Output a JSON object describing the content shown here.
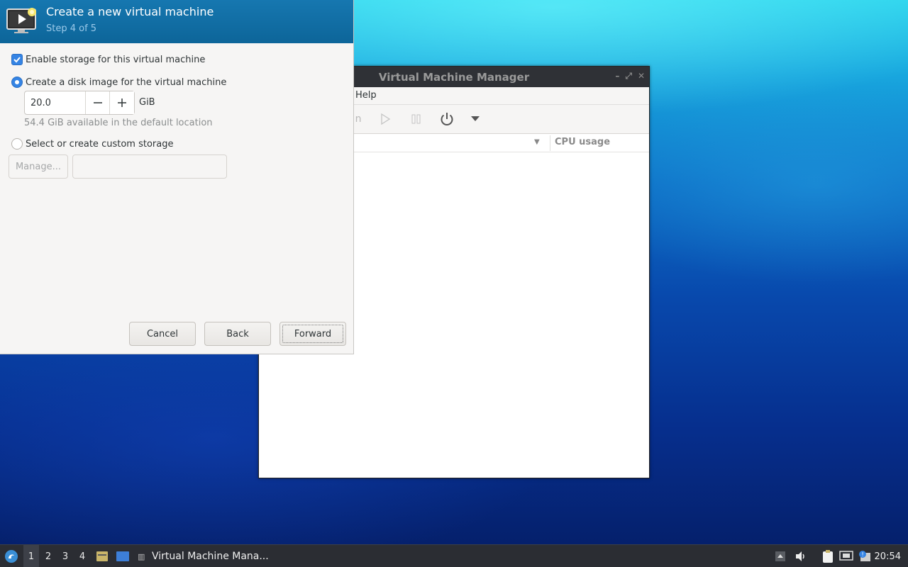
{
  "wizard": {
    "title": "Create a new virtual machine",
    "step": "Step 4 of 5",
    "enable_storage_label": "Enable storage for this virtual machine",
    "create_disk_label": "Create a disk image for the virtual machine",
    "disk_size_value": "20.0",
    "disk_unit": "GiB",
    "available_text": "54.4 GiB available in the default location",
    "custom_storage_label": "Select or create custom storage",
    "manage_label": "Manage...",
    "cancel_label": "Cancel",
    "back_label": "Back",
    "forward_label": "Forward"
  },
  "vmm": {
    "title": "Virtual Machine Manager",
    "menu_help": "Help",
    "column_cpu": "CPU usage"
  },
  "taskbar": {
    "workspaces": [
      "1",
      "2",
      "3",
      "4"
    ],
    "active_workspace": "1",
    "task_label": "Virtual Machine Mana...",
    "clock": "20:54"
  }
}
